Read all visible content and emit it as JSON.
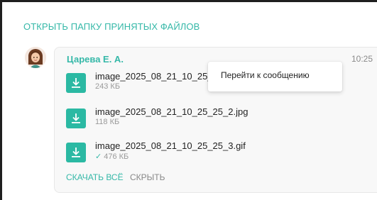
{
  "header": {
    "open_folder_label": "ОТКРЫТЬ ПАПКУ ПРИНЯТЫХ ФАЙЛОВ"
  },
  "message": {
    "sender": "Царева Е. А.",
    "time": "10:25",
    "files": [
      {
        "name": "image_2025_08_21_10_25_",
        "size": "243 КБ",
        "delivered": false
      },
      {
        "name": "image_2025_08_21_10_25_25_2.jpg",
        "size": "118 КБ",
        "delivered": false
      },
      {
        "name": "image_2025_08_21_10_25_25_3.gif",
        "size": "476 КБ",
        "delivered": true
      }
    ],
    "actions": {
      "download_all": "СКАЧАТЬ ВСЁ",
      "hide": "СКРЫТЬ"
    }
  },
  "context_menu": {
    "go_to_message": "Перейти к сообщению"
  },
  "icons": {
    "download": "download-icon",
    "avatar": "avatar",
    "delivered": "checkmark-icon"
  },
  "colors": {
    "accent": "#35b8a8",
    "button": "#2bb9a3"
  }
}
